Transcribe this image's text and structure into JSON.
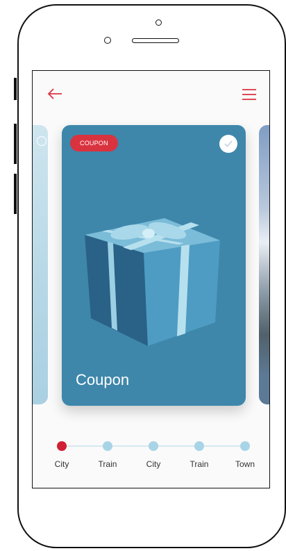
{
  "header": {
    "back_icon": "arrow-left-icon",
    "menu_icon": "hamburger-menu-icon",
    "accent_color": "#d9333f"
  },
  "carousel": {
    "active_card": {
      "badge": "COUPON",
      "title": "Coupon",
      "selected": true,
      "background_color": "#3e87ab",
      "image": "gift-box-illustration"
    }
  },
  "timeline": {
    "active_index": 0,
    "stops": [
      {
        "label": "City"
      },
      {
        "label": "Train"
      },
      {
        "label": "City"
      },
      {
        "label": "Train"
      },
      {
        "label": "Town"
      }
    ]
  }
}
